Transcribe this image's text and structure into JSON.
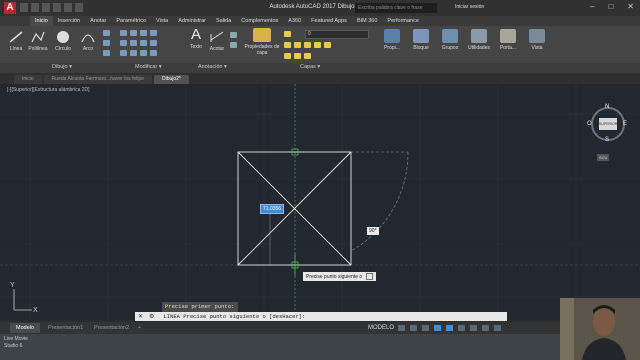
{
  "app": {
    "logo_letter": "A",
    "window_title": "Autodesk AutoCAD 2017    Dibujo2.dwg",
    "search_placeholder": "Escriba palabra clave o frase",
    "signin": "Iniciar sesión",
    "win_controls": [
      "–",
      "□",
      "✕"
    ]
  },
  "ribbon_tabs": [
    "Inicio",
    "Inserción",
    "Anotar",
    "Paramétrico",
    "Vista",
    "Administrar",
    "Salida",
    "Complementos",
    "A360",
    "Featured Apps",
    "BIM 360",
    "Performance"
  ],
  "ribbon": {
    "draw_tools": [
      "Línea",
      "Polilínea",
      "Círculo",
      "Arco"
    ],
    "text_tools": [
      "Texto",
      "Acotar"
    ],
    "layer_props": "Propiedades de capa",
    "layer_value": "0",
    "right_tools": [
      "Propi...",
      "Bloque",
      "Grupos",
      "Utilidades",
      "Porta...",
      "Vista"
    ],
    "panels": [
      "Dibujo ▾",
      "Modificar ▾",
      "Anotación ▾",
      "Capas ▾"
    ]
  },
  "file_tabs": [
    "Inicio",
    "Rueda Alcuota Ferrmaro...haver los felipe",
    "Dibujo2*"
  ],
  "viewport": {
    "label": "[-][Superior][Estructura alámbrica 2D]",
    "viewcube_top": "SUPERIOR",
    "compass": {
      "n": "N",
      "s": "S",
      "e": "E",
      "w": "O"
    },
    "wcs": "SCU",
    "dim_input": "71.0356",
    "angle_tooltip": "90°",
    "prompt_tooltip": "Precise punto siguiente o",
    "ucs_y": "Y",
    "ucs_x": "X"
  },
  "command": {
    "history": "Precise primer punto:",
    "line": "LINEA Precise punto siguiente o [desHacer]:"
  },
  "layout_tabs": [
    "Modelo",
    "Presentación1",
    "Presentación2",
    "+"
  ],
  "status_model": "MODELO",
  "taskbar_text": [
    "Live Movie",
    "Studio 6"
  ]
}
